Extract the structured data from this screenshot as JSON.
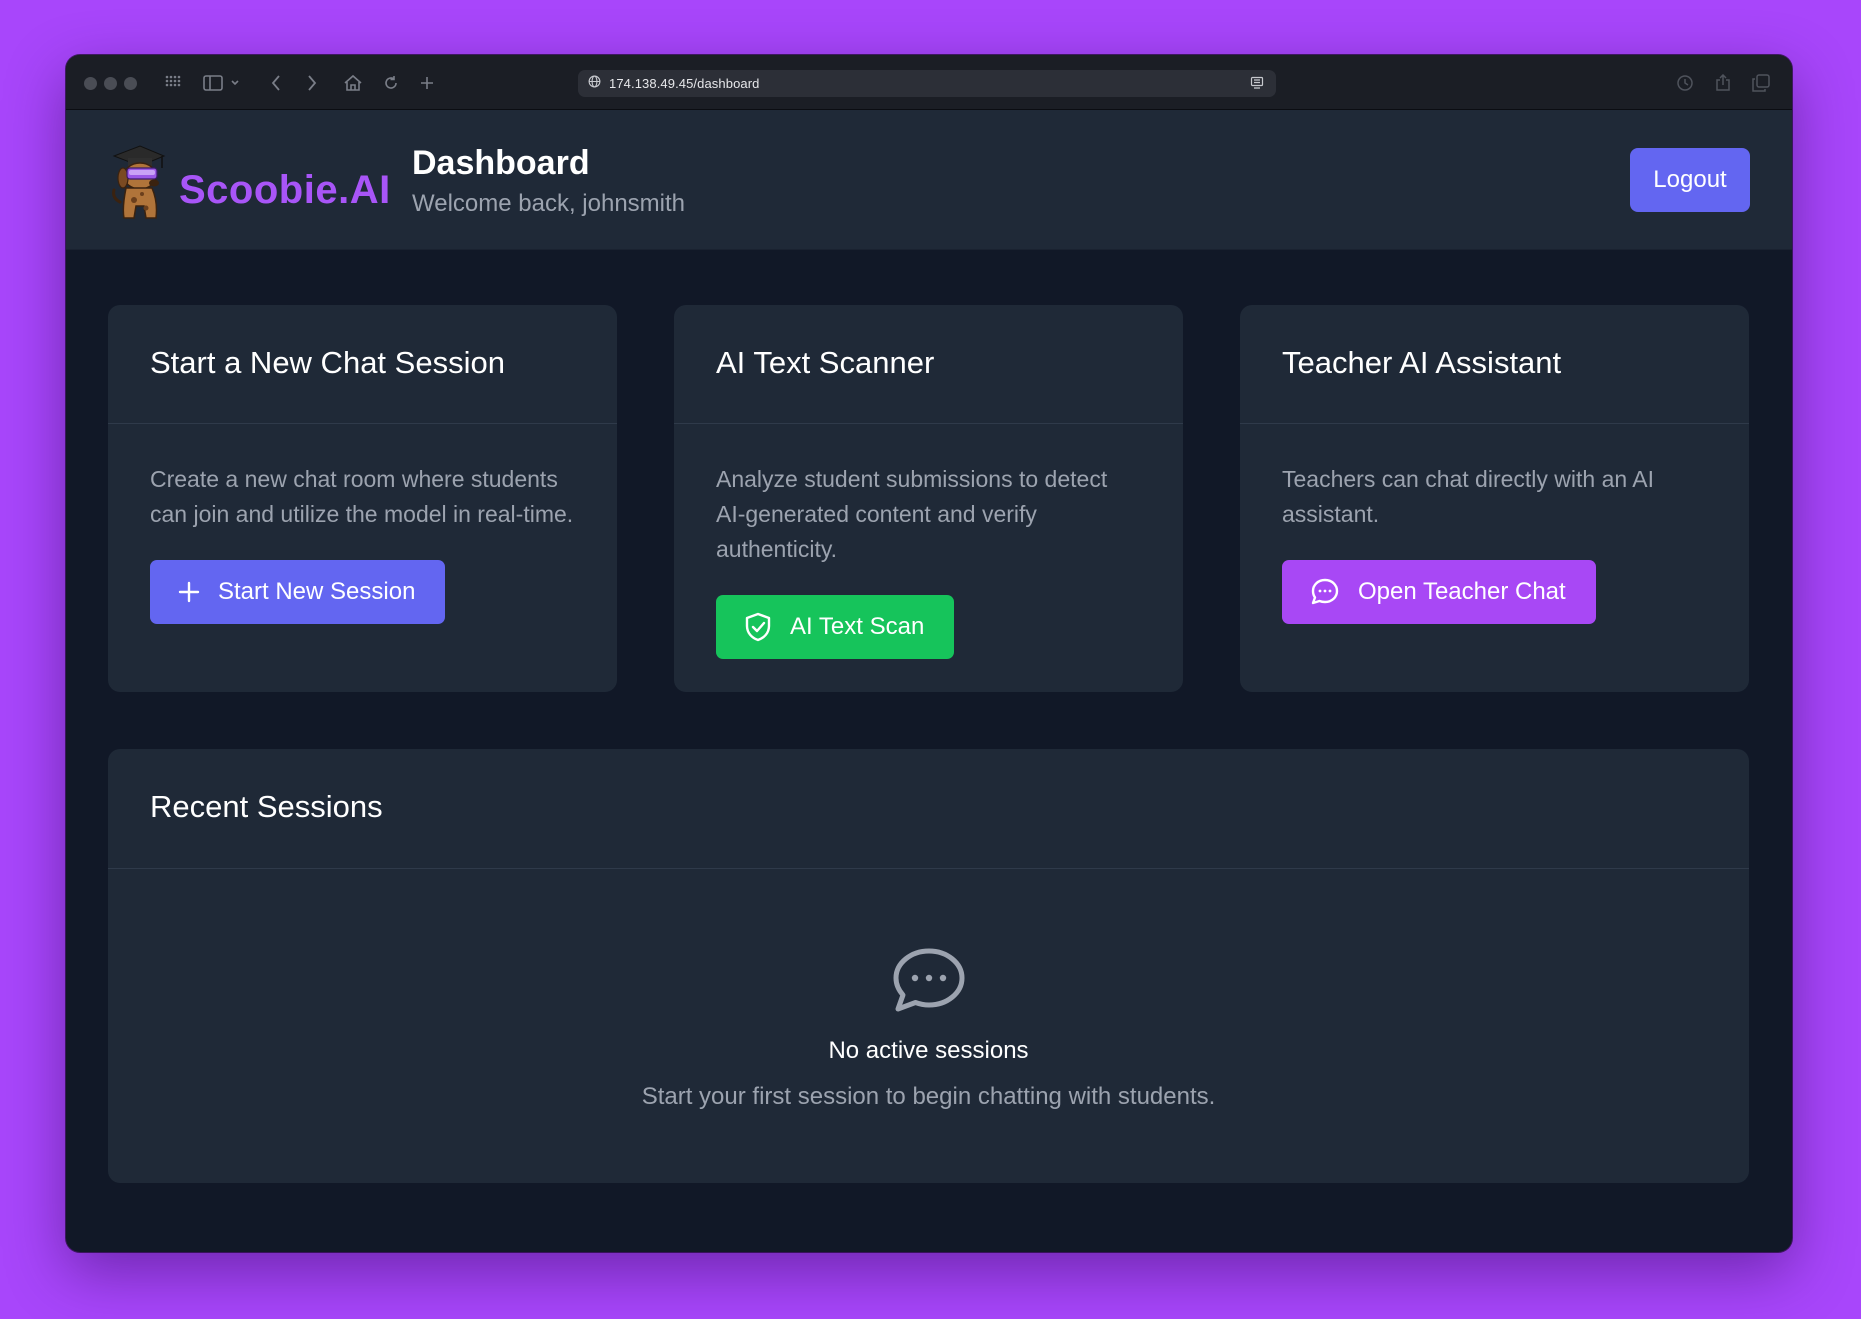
{
  "browser": {
    "url": "174.138.49.45/dashboard"
  },
  "header": {
    "brand": "Scoobie.AI",
    "title": "Dashboard",
    "subtitle": "Welcome back, johnsmith",
    "logout_label": "Logout"
  },
  "cards": [
    {
      "title": "Start a New Chat Session",
      "description": "Create a new chat room where students can join and utilize the model in real-time.",
      "button_label": "Start New Session",
      "button_icon": "plus-icon"
    },
    {
      "title": "AI Text Scanner",
      "description": "Analyze student submissions to detect AI-generated content and verify authenticity.",
      "button_label": "AI Text Scan",
      "button_icon": "shield-check-icon"
    },
    {
      "title": "Teacher AI Assistant",
      "description": "Teachers can chat directly with an AI assistant.",
      "button_label": "Open Teacher Chat",
      "button_icon": "chat-bubble-icon"
    }
  ],
  "recent": {
    "title": "Recent Sessions",
    "empty_title": "No active sessions",
    "empty_subtitle": "Start your first session to begin chatting with students."
  },
  "colors": {
    "page_background": "#a846fb",
    "app_background": "#111827",
    "panel": "#1f2937",
    "brand": "#a855f7",
    "primary": "#6366f1",
    "success": "#16c45b",
    "accent_purple": "#a848f5"
  }
}
